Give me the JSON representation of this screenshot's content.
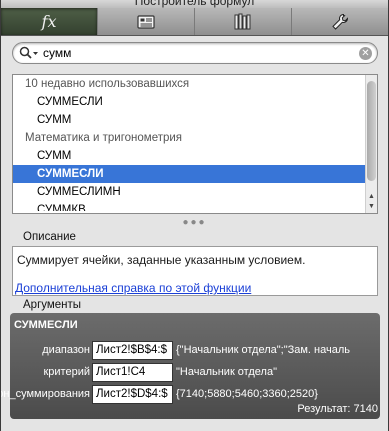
{
  "window": {
    "title": "Построитель формул"
  },
  "toolbar": {
    "tabs": [
      {
        "name": "tab-functions",
        "icon": "fx-icon",
        "glyph": "fx"
      },
      {
        "name": "tab-objects",
        "icon": "objects-icon"
      },
      {
        "name": "tab-library",
        "icon": "library-icon"
      },
      {
        "name": "tab-settings",
        "icon": "wrench-icon"
      }
    ]
  },
  "search": {
    "value": "сумм",
    "placeholder": ""
  },
  "function_list": {
    "rows": [
      {
        "kind": "group",
        "label": "10 недавно использовавшихся"
      },
      {
        "kind": "item",
        "label": "СУММЕСЛИ"
      },
      {
        "kind": "item",
        "label": "СУММ"
      },
      {
        "kind": "group",
        "label": "Математика и тригонометрия"
      },
      {
        "kind": "item",
        "label": "СУММ"
      },
      {
        "kind": "item",
        "label": "СУММЕСЛИ",
        "selected": true
      },
      {
        "kind": "item",
        "label": "СУММЕСЛИМН"
      },
      {
        "kind": "item",
        "label": "СУММКВ"
      }
    ]
  },
  "description": {
    "label": "Описание",
    "text": "Суммирует ячейки, заданные указанным условием.",
    "help_link": "Дополнительная справка по этой функции"
  },
  "arguments": {
    "label": "Аргументы",
    "function_name": "СУММЕСЛИ",
    "rows": [
      {
        "name": "диапазон",
        "input": "Лист2!$B$4:$",
        "value": "{\"Начальник отдела\";\"Зам. началь"
      },
      {
        "name": "критерий",
        "input": "Лист1!C4",
        "value": "\"Начальник отдела\""
      },
      {
        "name": "диапазон_суммирования",
        "input": "Лист2!$D$4:$",
        "value": "{7140;5880;5460;3360;2520}"
      }
    ],
    "result": "Результат: 7140"
  }
}
